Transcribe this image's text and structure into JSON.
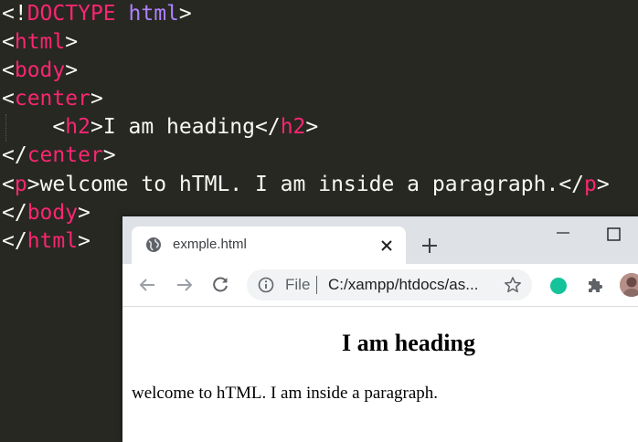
{
  "editor": {
    "lines": [
      {
        "punct_open": "<!",
        "keyword": "DOCTYPE",
        "space": " ",
        "attr": "html",
        "punct_close": ">"
      },
      {
        "open": "<",
        "tag": "html",
        "close": ">"
      },
      {
        "open": "<",
        "tag": "body",
        "close": ">"
      },
      {
        "open": "<",
        "tag": "center",
        "close": ">"
      },
      {
        "indent": "    ",
        "open": "<",
        "tag": "h2",
        "close": ">",
        "text": "I am heading",
        "end_open": "</",
        "end_tag": "h2",
        "end_close": ">"
      },
      {
        "open": "</",
        "tag": "center",
        "close": ">"
      },
      {
        "open": "<",
        "tag": "p",
        "close": ">",
        "text": "welcome to hTML. I am inside a paragraph.",
        "end_open": "</",
        "end_tag": "p",
        "end_close": ">"
      },
      {
        "open": "</",
        "tag": "body",
        "close": ">"
      },
      {
        "open": "</",
        "tag": "html",
        "close": ">"
      }
    ]
  },
  "browser": {
    "tab": {
      "title": "exmple.html"
    },
    "omnibox": {
      "scheme": "File",
      "url": "C:/xampp/htdocs/as..."
    },
    "page": {
      "heading": "I am heading",
      "paragraph": "welcome to hTML. I am inside a paragraph."
    }
  },
  "colors": {
    "editor_bg": "#272822",
    "editor_text": "#f8f8f2",
    "tag": "#f92672",
    "keyword": "#ae81ff",
    "titlebar": "#dee1e6",
    "omnibox_bg": "#f1f3f4",
    "grammarly": "#15c39a"
  },
  "icons": {
    "tab": "globe-icon",
    "close": "close-icon",
    "new_tab": "plus-icon",
    "back": "back-arrow-icon",
    "forward": "forward-arrow-icon",
    "reload": "reload-icon",
    "info": "info-icon",
    "bookmark": "star-icon",
    "grammarly": "grammarly-icon",
    "extensions": "puzzle-icon",
    "profile": "avatar"
  }
}
